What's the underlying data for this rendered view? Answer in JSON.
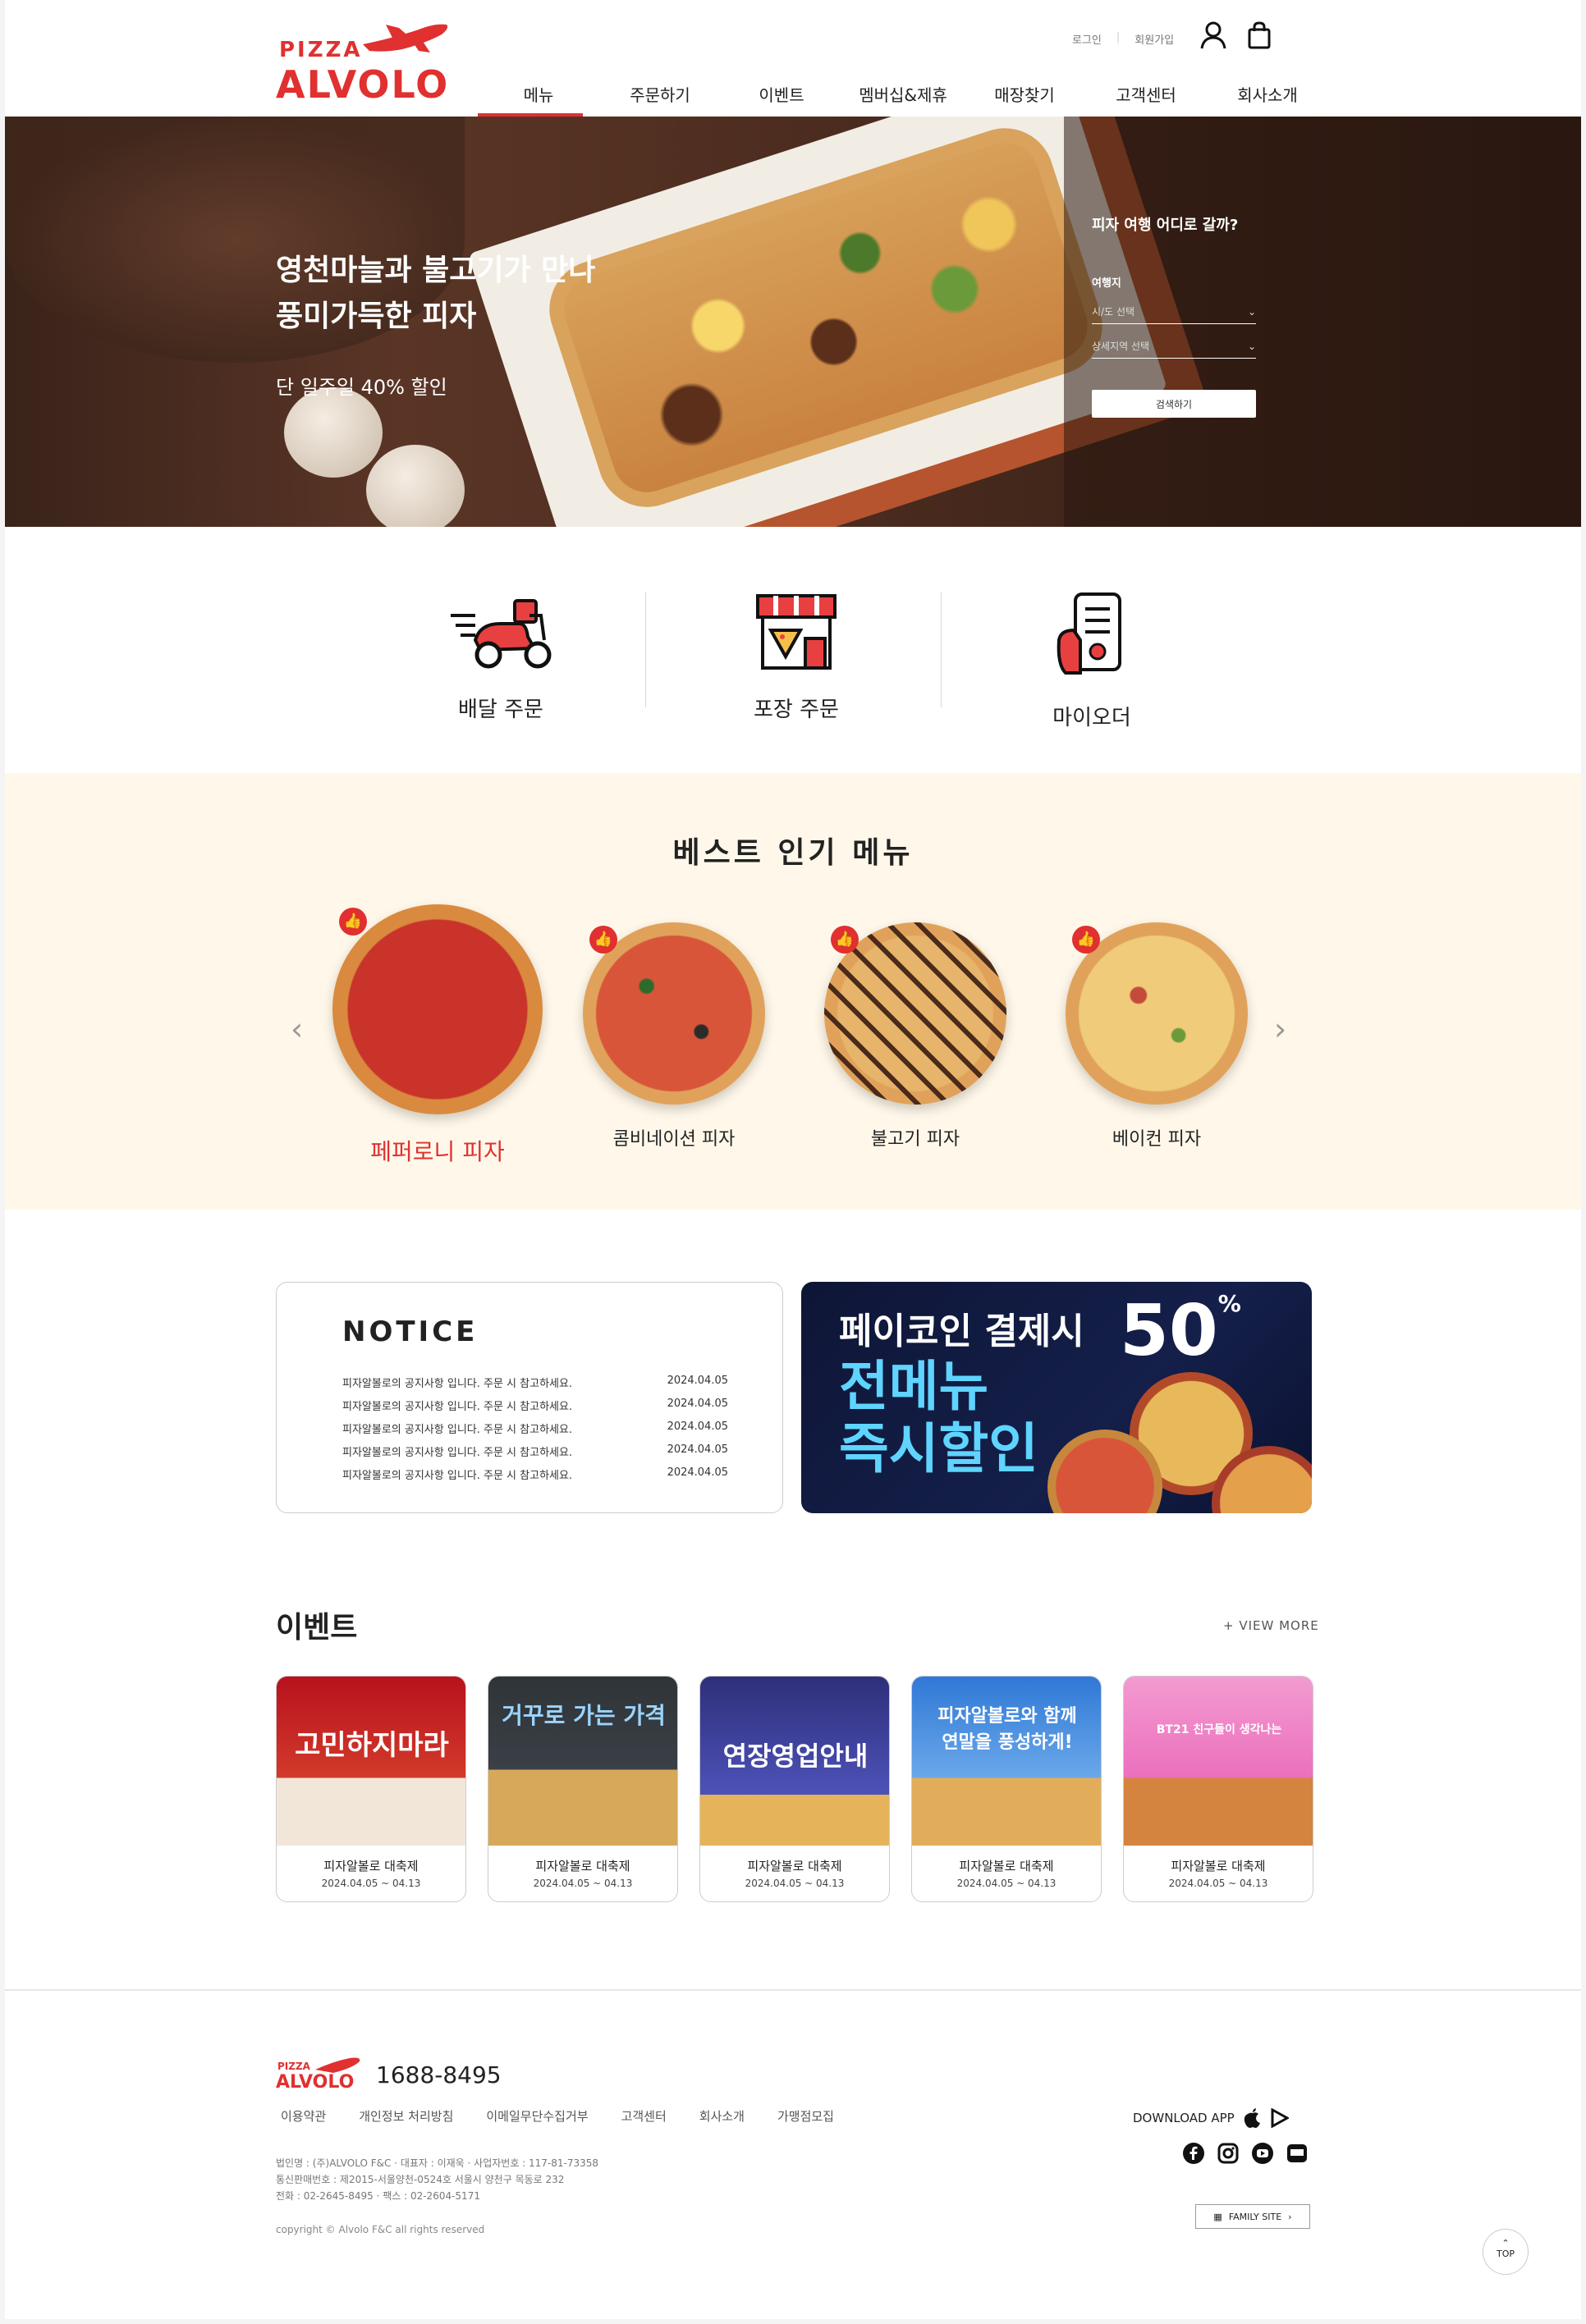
{
  "header": {
    "logo_top": "PIZZA",
    "logo_main": "ALVOLO",
    "login": "로그인",
    "signup": "회원가입",
    "nav": [
      "메뉴",
      "주문하기",
      "이벤트",
      "멤버십&제휴",
      "매장찾기",
      "고객센터",
      "회사소개"
    ]
  },
  "hero": {
    "line1": "영천마늘과 불고기가 만나",
    "line2": "풍미가득한 피자",
    "sub": "단 일주일 40% 할인",
    "finder_title": "피자 여행 어디로 갈까?",
    "finder_label": "여행지",
    "select1": "시/도 선택",
    "select2": "상세지역 선택",
    "search_button": "검색하기"
  },
  "order": {
    "items": [
      {
        "label": "배달 주문",
        "icon": "scooter-icon"
      },
      {
        "label": "포장 주문",
        "icon": "store-pizza-icon"
      },
      {
        "label": "마이오더",
        "icon": "phone-order-icon"
      }
    ]
  },
  "best": {
    "title": "베스트 인기 메뉴",
    "items": [
      "페퍼로니 피자",
      "콤비네이션 피자",
      "불고기 피자",
      "베이컨 피자"
    ]
  },
  "notice": {
    "title": "NOTICE",
    "rows": [
      {
        "text": "피자알볼로의 공지사항 입니다. 주문 시 참고하세요.",
        "date": "2024.04.05"
      },
      {
        "text": "피자알볼로의 공지사항 입니다. 주문 시 참고하세요.",
        "date": "2024.04.05"
      },
      {
        "text": "피자알볼로의 공지사항 입니다. 주문 시 참고하세요.",
        "date": "2024.04.05"
      },
      {
        "text": "피자알볼로의 공지사항 입니다. 주문 시 참고하세요.",
        "date": "2024.04.05"
      },
      {
        "text": "피자알볼로의 공지사항 입니다. 주문 시 참고하세요.",
        "date": "2024.04.05"
      }
    ]
  },
  "promo": {
    "line1": "페이코인 결제시",
    "line2": "전메뉴",
    "line3": "즉시할인",
    "percent": "50",
    "percent_sign": "%"
  },
  "events": {
    "title": "이벤트",
    "more": "+ VIEW MORE",
    "cards": [
      {
        "banner": "고민하지마라",
        "caption": "피자알볼로 대축제",
        "date": "2024.04.05 ~ 04.13",
        "bg": "#c8202a"
      },
      {
        "banner": "거꾸로 가는 가격",
        "caption": "피자알볼로 대축제",
        "date": "2024.04.05 ~ 04.13",
        "bg": "#2f3438"
      },
      {
        "banner": "연장영업안내",
        "caption": "피자알볼로 대축제",
        "date": "2024.04.05 ~ 04.13",
        "bg": "#3a3f9a"
      },
      {
        "banner": "피자알볼로와 함께 연말을 풍성하게!",
        "caption": "피자알볼로 대축제",
        "date": "2024.04.05 ~ 04.13",
        "bg": "#4d8ed8"
      },
      {
        "banner": "BT21 친구들이 생각나는",
        "caption": "피자알볼로 대축제",
        "date": "2024.04.05 ~ 04.13",
        "bg": "#f07cc0"
      }
    ]
  },
  "footer": {
    "phone": "1688-8495",
    "links": [
      "이용약관",
      "개인정보 처리방침",
      "이메일무단수집거부",
      "고객센터",
      "회사소개",
      "가맹점모집"
    ],
    "info1": "법인명 : (주)ALVOLO F&C · 대표자 : 이재욱 · 사업자번호 : 117-81-73358",
    "info2": "통신판매번호 : 제2015-서울양천-0524호 서울시 양천구 목동로 232",
    "info3": "전화 : 02-2645-8495 · 팩스 : 02-2604-5171",
    "copyright": "copyright © Alvolo F&C all rights reserved",
    "download": "DOWNLOAD APP",
    "family": "FAMILY SITE",
    "top": "TOP"
  },
  "colors": {
    "accent": "#e03030",
    "best_bg": "#fff8ea"
  }
}
